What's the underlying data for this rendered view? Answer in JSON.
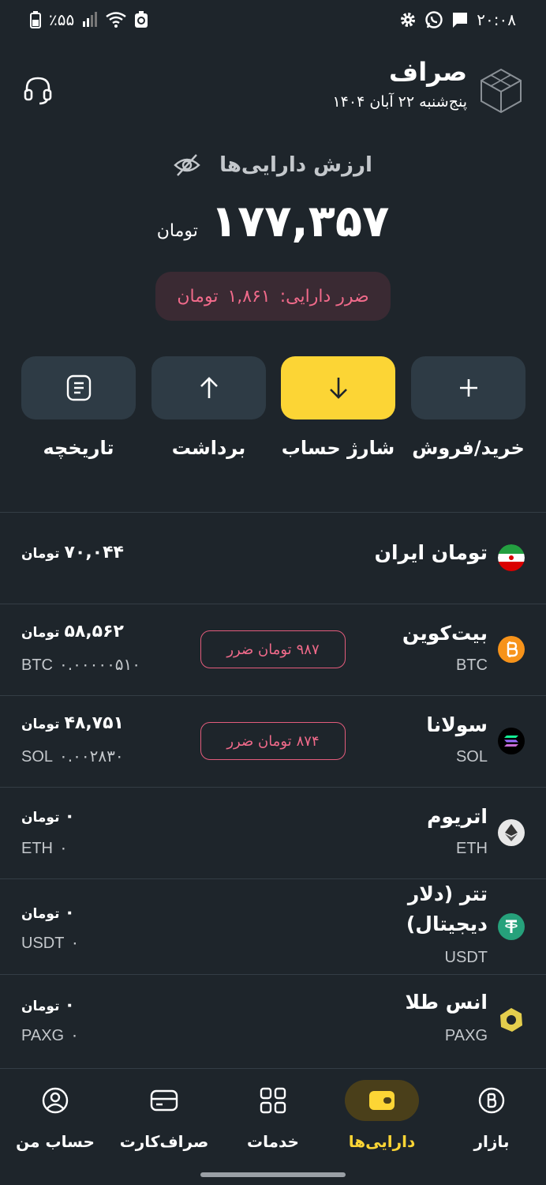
{
  "status_bar": {
    "time": "۲۰:۰۸",
    "battery": "٪۵۵"
  },
  "header": {
    "title": "صراف",
    "date": "پنج‌شنبه ۲۲ آبان ۱۴۰۴"
  },
  "balance": {
    "label": "ارزش دارایی‌ها",
    "value": "۱۷۷,۳۵۷",
    "unit": "تومان",
    "loss_label": "ضرر دارایی:",
    "loss_value": "۱,۸۶۱",
    "loss_unit": "تومان"
  },
  "actions": [
    {
      "label": "خرید/فروش"
    },
    {
      "label": "شارژ حساب"
    },
    {
      "label": "برداشت"
    },
    {
      "label": "تاریخچه"
    }
  ],
  "assets": [
    {
      "name": "تومان ایران",
      "value": "۷۰,۰۴۴",
      "unit": "تومان"
    },
    {
      "name": "بیت‌کوین",
      "symbol": "BTC",
      "value": "۵۸,۵۶۲",
      "unit": "تومان",
      "amount": "۰.۰۰۰۰۰۵۱۰",
      "pl_value": "۹۸۷",
      "pl_label": "تومان ضرر"
    },
    {
      "name": "سولانا",
      "symbol": "SOL",
      "value": "۴۸,۷۵۱",
      "unit": "تومان",
      "amount": "۰.۰۰۲۸۳۰",
      "pl_value": "۸۷۴",
      "pl_label": "تومان ضرر"
    },
    {
      "name": "اتریوم",
      "symbol": "ETH",
      "value": "۰",
      "unit": "تومان",
      "amount": "۰"
    },
    {
      "name_line1": "تتر (دلار",
      "name_line2": "دیجیتال)",
      "symbol": "USDT",
      "value": "۰",
      "unit": "تومان",
      "amount": "۰"
    },
    {
      "name": "انس طلا",
      "symbol": "PAXG",
      "value": "۰",
      "unit": "تومان",
      "amount": "۰"
    }
  ],
  "nav": [
    {
      "label": "بازار"
    },
    {
      "label": "دارایی‌ها"
    },
    {
      "label": "خدمات"
    },
    {
      "label": "صراف‌کارت"
    },
    {
      "label": "حساب من"
    }
  ],
  "colors": {
    "background": "#1e252b",
    "accent": "#fcd535",
    "loss": "#f06a8a",
    "card": "#2e3b45"
  }
}
